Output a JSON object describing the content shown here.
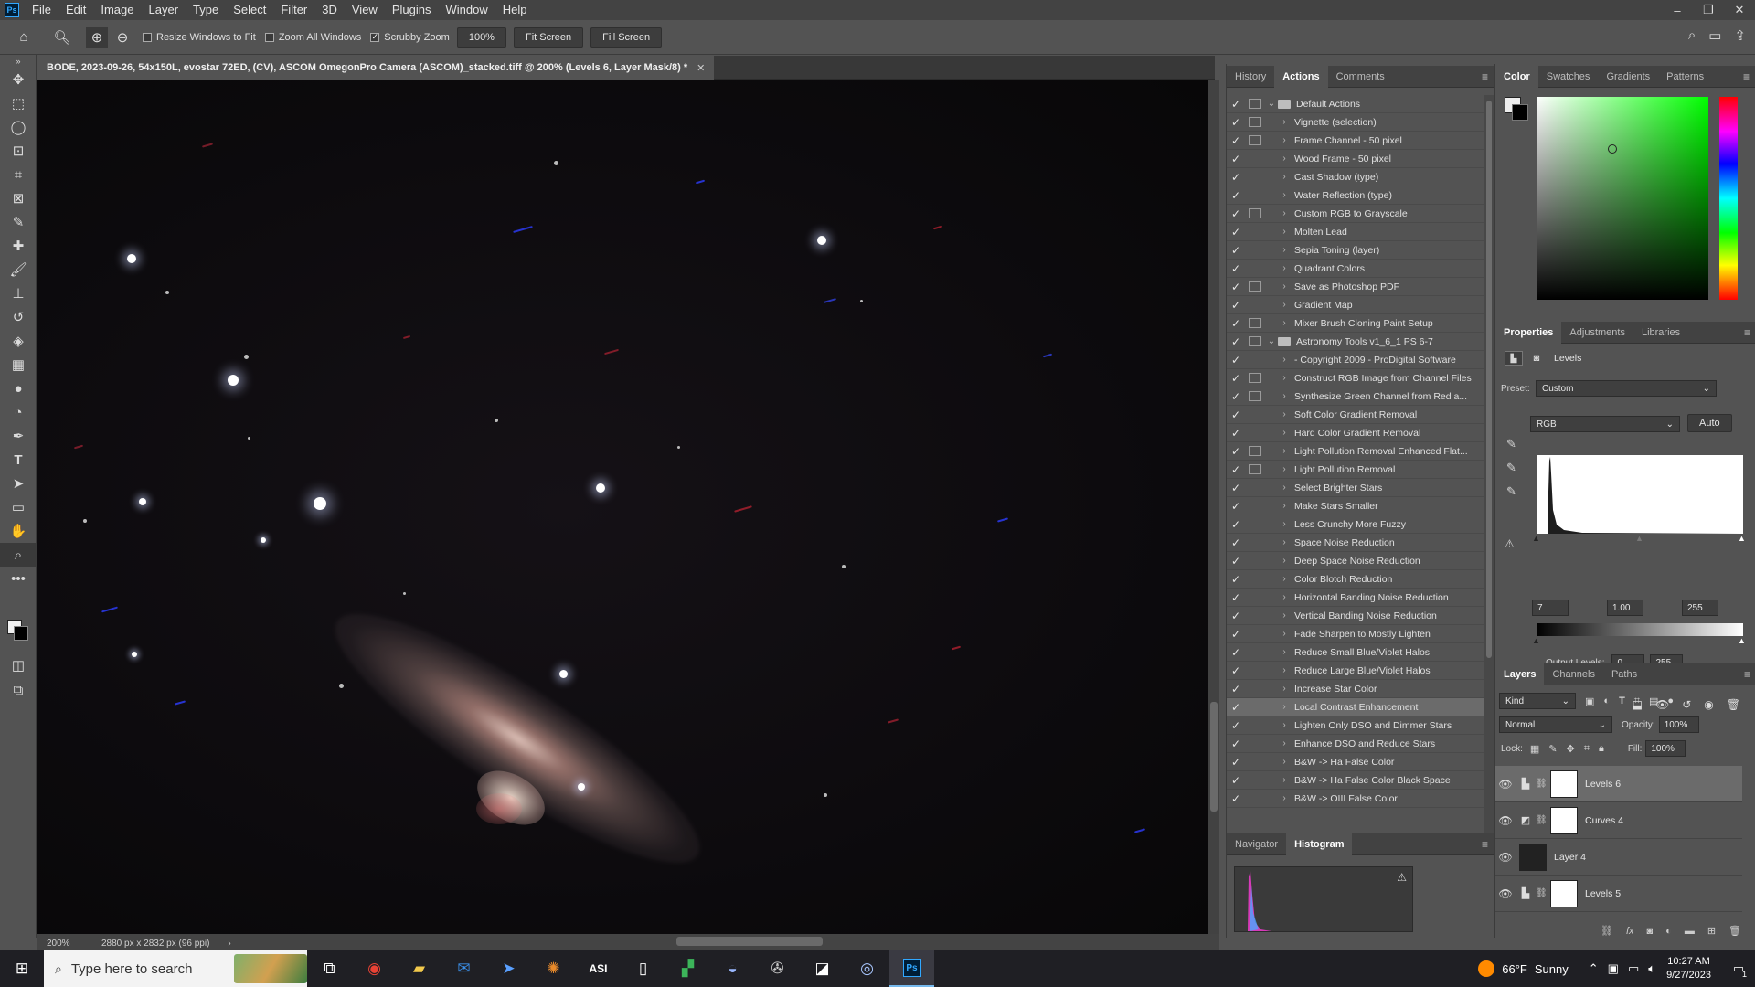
{
  "menubar": {
    "logo": "Ps",
    "items": [
      "File",
      "Edit",
      "Image",
      "Layer",
      "Type",
      "Select",
      "Filter",
      "3D",
      "View",
      "Plugins",
      "Window",
      "Help"
    ]
  },
  "options": {
    "resize_windows": "Resize Windows to Fit",
    "zoom_all": "Zoom All Windows",
    "scrubby": "Scrubby Zoom",
    "zoom_value": "100%",
    "fit_screen": "Fit Screen",
    "fill_screen": "Fill Screen"
  },
  "document": {
    "tab_title": "BODE, 2023-09-26, 54x150L, evostar 72ED, (CV), ASCOM OmegonPro Camera (ASCOM)_stacked.tiff @ 200% (Levels 6, Layer Mask/8) *",
    "zoom": "200%",
    "info": "2880 px x 2832 px (96 ppi)"
  },
  "actions_panel": {
    "tabs": [
      "History",
      "Actions",
      "Comments"
    ],
    "active_tab": "Actions",
    "rows": [
      {
        "label": "Default Actions",
        "set": true,
        "dialog": true
      },
      {
        "label": "Vignette (selection)",
        "dialog": true
      },
      {
        "label": "Frame Channel - 50 pixel",
        "dialog": true
      },
      {
        "label": "Wood Frame - 50 pixel",
        "dialog": false
      },
      {
        "label": "Cast Shadow (type)",
        "dialog": false
      },
      {
        "label": "Water Reflection (type)",
        "dialog": false
      },
      {
        "label": "Custom RGB to Grayscale",
        "dialog": true
      },
      {
        "label": "Molten Lead",
        "dialog": false
      },
      {
        "label": "Sepia Toning (layer)",
        "dialog": false
      },
      {
        "label": "Quadrant Colors",
        "dialog": false
      },
      {
        "label": "Save as Photoshop PDF",
        "dialog": true
      },
      {
        "label": "Gradient Map",
        "dialog": false
      },
      {
        "label": "Mixer Brush Cloning Paint Setup",
        "dialog": true
      },
      {
        "label": "Astronomy Tools v1_6_1 PS 6-7",
        "set": true,
        "dialog": true
      },
      {
        "label": "- Copyright 2009 - ProDigital Software",
        "dialog": false
      },
      {
        "label": "Construct RGB Image from Channel Files",
        "dialog": true
      },
      {
        "label": "Synthesize Green Channel from Red a...",
        "dialog": true
      },
      {
        "label": "Soft Color Gradient Removal",
        "dialog": false
      },
      {
        "label": "Hard Color Gradient Removal",
        "dialog": false
      },
      {
        "label": "Light Pollution Removal Enhanced Flat...",
        "dialog": true
      },
      {
        "label": "Light Pollution Removal",
        "dialog": true
      },
      {
        "label": "Select Brighter Stars",
        "dialog": false
      },
      {
        "label": "Make Stars Smaller",
        "dialog": false
      },
      {
        "label": "Less Crunchy More Fuzzy",
        "dialog": false
      },
      {
        "label": "Space Noise Reduction",
        "dialog": false
      },
      {
        "label": "Deep Space Noise Reduction",
        "dialog": false
      },
      {
        "label": "Color Blotch Reduction",
        "dialog": false
      },
      {
        "label": "Horizontal Banding Noise Reduction",
        "dialog": false
      },
      {
        "label": "Vertical Banding Noise Reduction",
        "dialog": false
      },
      {
        "label": "Fade Sharpen to Mostly Lighten",
        "dialog": false
      },
      {
        "label": "Reduce Small Blue/Violet Halos",
        "dialog": false
      },
      {
        "label": "Reduce Large Blue/Violet Halos",
        "dialog": false
      },
      {
        "label": "Increase Star Color",
        "dialog": false
      },
      {
        "label": "Local Contrast Enhancement",
        "dialog": false,
        "selected": true
      },
      {
        "label": "Lighten Only DSO and Dimmer Stars",
        "dialog": false
      },
      {
        "label": "Enhance DSO and Reduce Stars",
        "dialog": false
      },
      {
        "label": "B&W -> Ha False Color",
        "dialog": false
      },
      {
        "label": "B&W -> Ha False Color Black Space",
        "dialog": false
      },
      {
        "label": "B&W -> OIII False Color",
        "dialog": false
      }
    ]
  },
  "nav_panel": {
    "tabs": [
      "Navigator",
      "Histogram"
    ],
    "active_tab": "Histogram"
  },
  "color_panel": {
    "tabs": [
      "Color",
      "Swatches",
      "Gradients",
      "Patterns"
    ],
    "active_tab": "Color",
    "foreground": "#f0f0f0",
    "background": "#000000"
  },
  "properties_panel": {
    "tabs": [
      "Properties",
      "Adjustments",
      "Libraries"
    ],
    "active_tab": "Properties",
    "title": "Levels",
    "preset_label": "Preset:",
    "preset_value": "Custom",
    "channel": "RGB",
    "auto": "Auto",
    "input_black": "7",
    "input_gamma": "1.00",
    "input_white": "255",
    "output_label": "Output Levels:",
    "output_black": "0",
    "output_white": "255"
  },
  "layers_panel": {
    "tabs": [
      "Layers",
      "Channels",
      "Paths"
    ],
    "active_tab": "Layers",
    "kind": "Kind",
    "blend_mode": "Normal",
    "opacity_label": "Opacity:",
    "opacity": "100%",
    "lock_label": "Lock:",
    "fill_label": "Fill:",
    "fill": "100%",
    "layers": [
      {
        "name": "Levels 6",
        "type": "levels",
        "selected": true
      },
      {
        "name": "Curves 4",
        "type": "curves"
      },
      {
        "name": "Layer 4",
        "type": "pixel"
      },
      {
        "name": "Levels 5",
        "type": "levels"
      }
    ]
  },
  "taskbar": {
    "search_placeholder": "Type here to search",
    "temperature": "66°F",
    "condition": "Sunny",
    "time": "10:27 AM",
    "date": "9/27/2023",
    "notification_count": "1"
  }
}
